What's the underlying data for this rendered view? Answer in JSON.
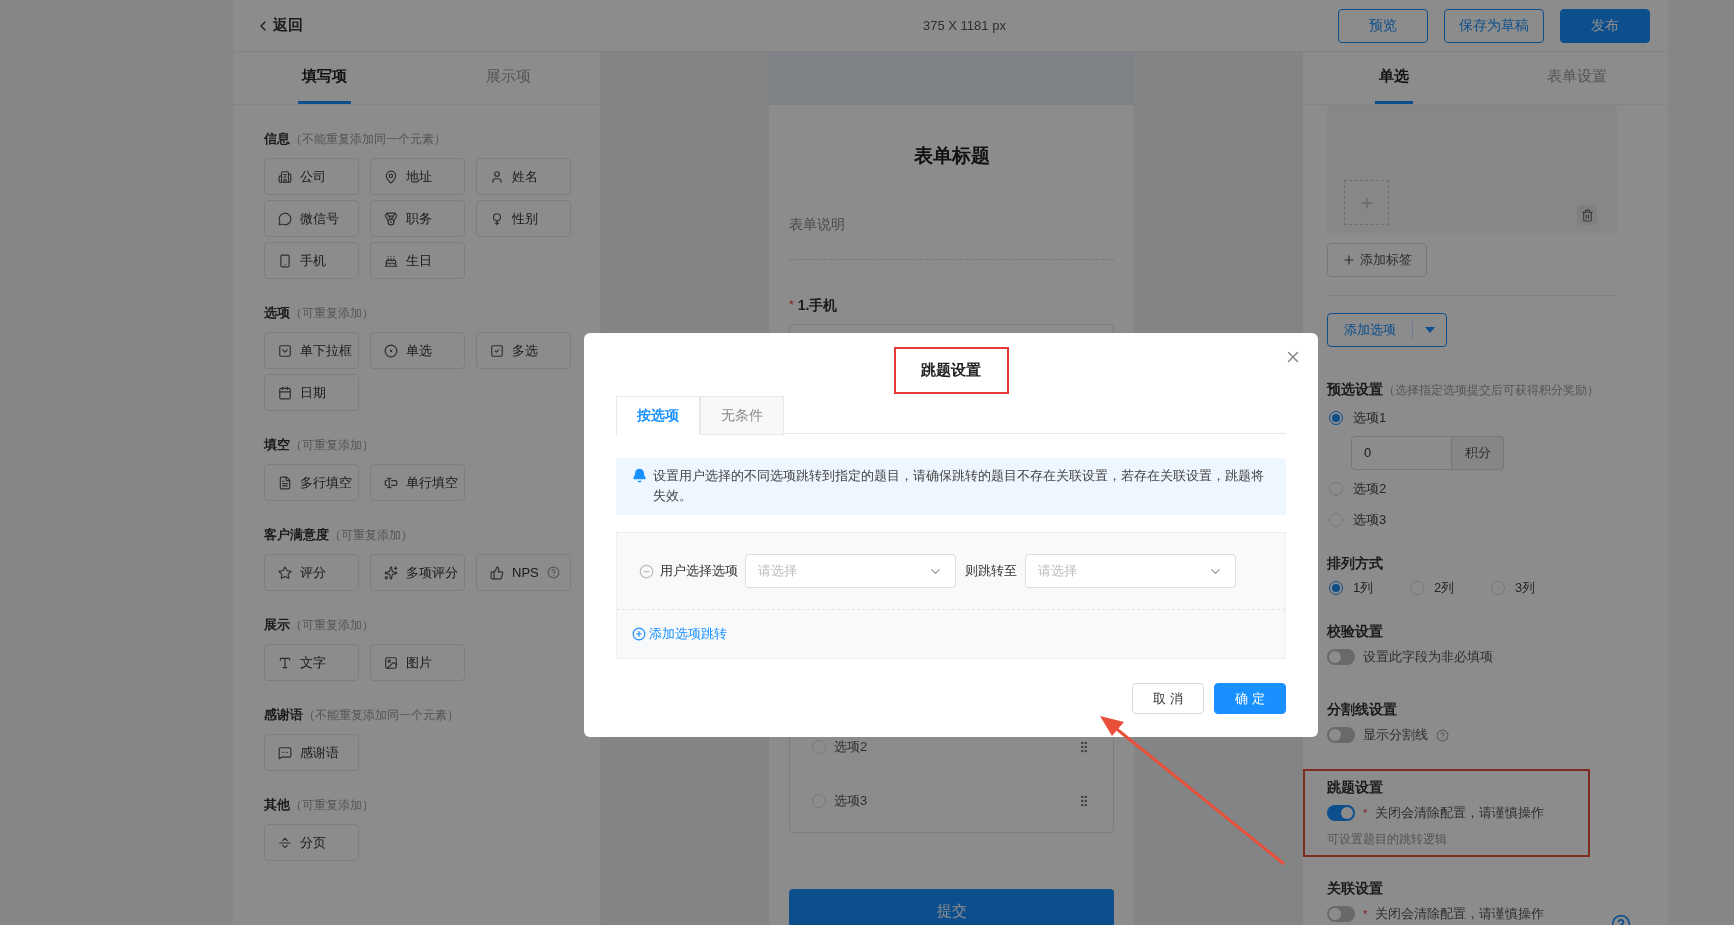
{
  "header": {
    "back": "返回",
    "canvas_size": "375 X 1181 px",
    "buttons": [
      {
        "label": "预览",
        "kind": "outline"
      },
      {
        "label": "保存为草稿",
        "kind": "outline"
      },
      {
        "label": "发布",
        "kind": "primary"
      }
    ]
  },
  "left_panel": {
    "tabs": [
      {
        "label": "填写项",
        "selected": true
      },
      {
        "label": "展示项",
        "selected": false
      }
    ],
    "groups": [
      {
        "title": "信息",
        "note": "（不能重复添加同一个元素）",
        "items": [
          {
            "label": "公司",
            "kind": "company"
          },
          {
            "label": "地址",
            "kind": "address"
          },
          {
            "label": "姓名",
            "kind": "name"
          },
          {
            "label": "微信号",
            "kind": "wechat"
          },
          {
            "label": "职务",
            "kind": "job"
          },
          {
            "label": "性别",
            "kind": "gender"
          },
          {
            "label": "手机",
            "kind": "phone"
          },
          {
            "label": "生日",
            "kind": "birthday"
          }
        ]
      },
      {
        "title": "选项",
        "note": "（可重复添加）",
        "items": [
          {
            "label": "单下拉框",
            "kind": "dropdown"
          },
          {
            "label": "单选",
            "kind": "radio"
          },
          {
            "label": "多选",
            "kind": "checkbox"
          },
          {
            "label": "日期",
            "kind": "date"
          }
        ]
      },
      {
        "title": "填空",
        "note": "（可重复添加）",
        "items": [
          {
            "label": "多行填空",
            "kind": "multiline"
          },
          {
            "label": "单行填空",
            "kind": "singleline"
          }
        ]
      },
      {
        "title": "客户满意度",
        "note": "（可重复添加）",
        "items": [
          {
            "label": "评分",
            "kind": "rating"
          },
          {
            "label": "多项评分",
            "kind": "multirating"
          },
          {
            "label": "NPS",
            "kind": "nps"
          }
        ]
      },
      {
        "title": "展示",
        "note": "（可重复添加）",
        "items": [
          {
            "label": "文字",
            "kind": "text"
          },
          {
            "label": "图片",
            "kind": "image"
          }
        ]
      },
      {
        "title": "感谢语",
        "note": "（不能重复添加同一个元素）",
        "items": [
          {
            "label": "感谢语",
            "kind": "thanks"
          }
        ]
      },
      {
        "title": "其他",
        "note": "（可重复添加）",
        "items": [
          {
            "label": "分页",
            "kind": "pagebreak"
          }
        ]
      }
    ]
  },
  "form": {
    "title": "表单标题",
    "description": "表单说明",
    "question": {
      "mark": "*",
      "label": "1.手机"
    },
    "options": [
      {
        "label": "选项2",
        "selected": false
      },
      {
        "label": "选项3",
        "selected": false
      }
    ],
    "submit": "提交"
  },
  "right_panel": {
    "tabs": [
      {
        "label": "单选",
        "selected": true
      },
      {
        "label": "表单设置",
        "selected": false
      }
    ],
    "add_tag": "添加标签",
    "add_option": "添加选项",
    "preset": {
      "title": "预选设置",
      "note": "（选择指定选项提交后可获得积分奖励）",
      "options": [
        {
          "label": "选项1",
          "selected": true
        },
        {
          "label": "选项2",
          "selected": false
        },
        {
          "label": "选项3",
          "selected": false
        }
      ],
      "score_value": "0",
      "score_unit": "积分"
    },
    "layout": {
      "title": "排列方式",
      "options": [
        {
          "label": "1列",
          "selected": true
        },
        {
          "label": "2列",
          "selected": false
        },
        {
          "label": "3列",
          "selected": false
        }
      ]
    },
    "sections": [
      {
        "title": "校验设置",
        "on": false,
        "text": "设置此字段为非必填项",
        "help": false,
        "highlighted": false
      },
      {
        "title": "分割线设置",
        "on": false,
        "text": "显示分割线",
        "help": true,
        "highlighted": false
      },
      {
        "title": "跳题设置",
        "on": true,
        "mark": "*",
        "text": "关闭会清除配置，请谨慎操作",
        "hint": "可设置题目的跳转逻辑",
        "help": false,
        "highlighted": true
      },
      {
        "title": "关联设置",
        "on": false,
        "mark": "*",
        "text": "关闭会清除配置，请谨慎操作",
        "help": false,
        "highlighted": false
      }
    ]
  },
  "dialog": {
    "title": "跳题设置",
    "title_highlighted": true,
    "tabs": [
      {
        "label": "按选项",
        "selected": true
      },
      {
        "label": "无条件",
        "selected": false
      }
    ],
    "notice": "设置用户选择的不同选项跳转到指定的题目，请确保跳转的题目不存在关联设置，若存在关联设置，跳题将失效。",
    "rules": [
      {
        "label": "用户选择选项",
        "source_placeholder": "请选择",
        "then": "则跳转至",
        "target_placeholder": "请选择"
      }
    ],
    "add_link": "添加选项跳转",
    "buttons": [
      {
        "label": "取消",
        "kind": "default"
      },
      {
        "label": "确定",
        "kind": "primary"
      }
    ]
  }
}
